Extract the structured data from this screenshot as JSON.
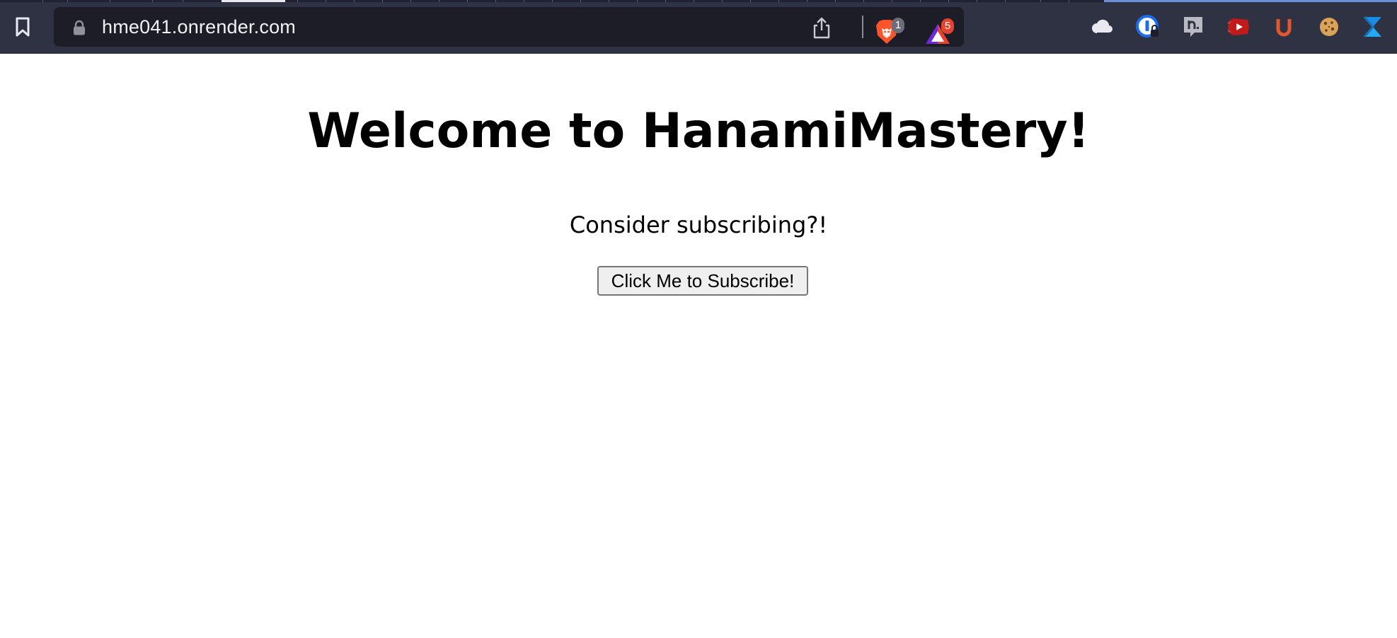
{
  "browser": {
    "url": "hme041.onrender.com",
    "brave_shields_count": "1",
    "rewards_count": "5",
    "extensions": [
      "cloud-icon",
      "password-manager-icon",
      "hacker-news-icon",
      "video-extension-icon",
      "ublock-icon",
      "cookie-icon",
      "translate-icon"
    ],
    "colors": {
      "toolbar": "#2f3243",
      "urlbar": "#1c1d26",
      "brave_orange": "#fb542b",
      "badge_gray": "#6b6e7a",
      "badge_red": "#e5432f"
    }
  },
  "page": {
    "heading": "Welcome to HanamiMastery!",
    "subtitle": "Consider subscribing?!",
    "subscribe_button_label": "Click Me to Subscribe!"
  }
}
